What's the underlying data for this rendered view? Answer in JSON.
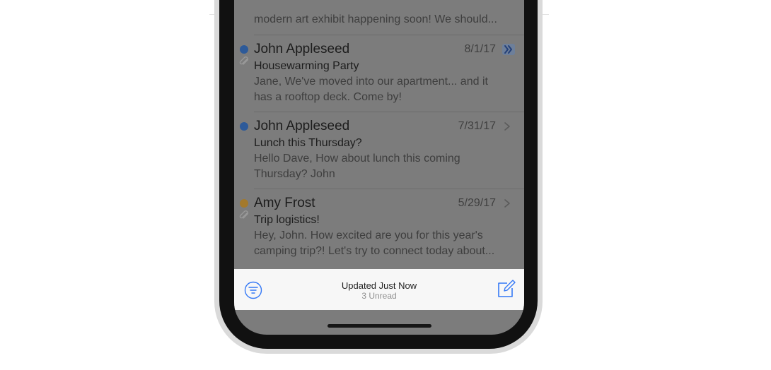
{
  "colors": {
    "unread_dot": "#2d5a99",
    "flag_dot": "#a3792b",
    "accent": "#3478f6"
  },
  "list": {
    "top_snippet": "modern art exhibit happening soon! We should...",
    "messages": [
      {
        "sender": "John Appleseed",
        "date": "8/1/17",
        "subject": "Housewarming Party",
        "preview": "Jane, We've moved into our apartment... and it has a rooftop deck. Come by!",
        "dot": "unread",
        "attachment": true,
        "thread_icon": "double-chevron-icon"
      },
      {
        "sender": "John Appleseed",
        "date": "7/31/17",
        "subject": "Lunch this Thursday?",
        "preview": "Hello Dave, How about lunch this coming Thursday? John",
        "dot": "unread",
        "attachment": false,
        "thread_icon": "chevron-right-icon"
      },
      {
        "sender": "Amy Frost",
        "date": "5/29/17",
        "subject": "Trip logistics!",
        "preview": "Hey, John. How excited are you for this year's camping trip?! Let's try to connect today about...",
        "dot": "flagged",
        "attachment": true,
        "thread_icon": "chevron-right-icon"
      }
    ]
  },
  "toolbar": {
    "status": "Updated Just Now",
    "unread": "3 Unread",
    "filter_icon": "filter-icon",
    "compose_icon": "compose-icon"
  }
}
